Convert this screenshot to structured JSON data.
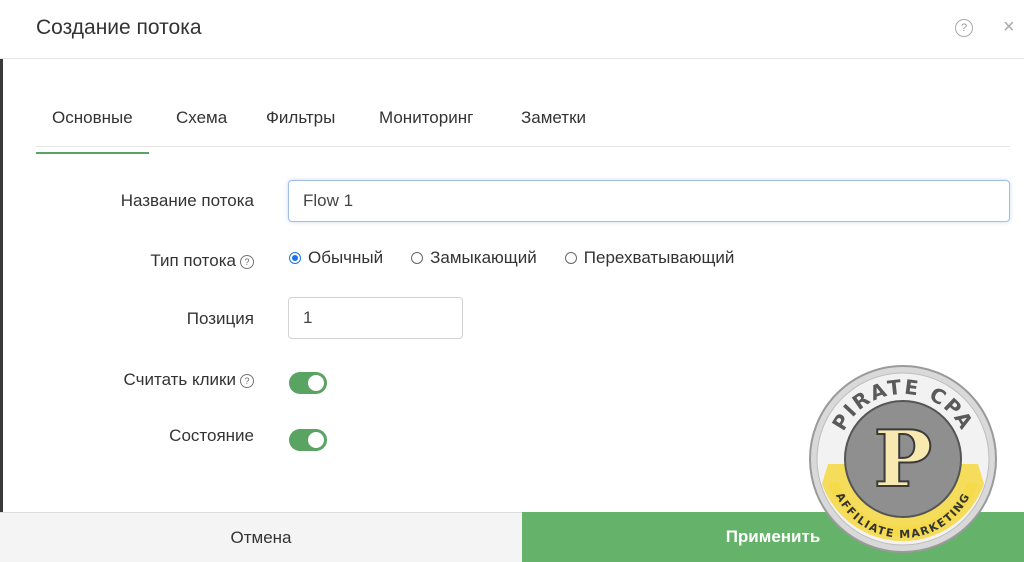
{
  "dialog": {
    "title": "Создание потока",
    "help_icon": "question-circle-icon",
    "close_icon": "close-icon",
    "close_glyph": "×",
    "help_glyph": "?"
  },
  "tabs": [
    {
      "label": "Основные",
      "active": true
    },
    {
      "label": "Схема",
      "active": false
    },
    {
      "label": "Фильтры",
      "active": false
    },
    {
      "label": "Мониторинг",
      "active": false
    },
    {
      "label": "Заметки",
      "active": false
    }
  ],
  "form": {
    "name": {
      "label": "Название потока",
      "value": "Flow 1"
    },
    "type": {
      "label": "Тип потока",
      "options": [
        {
          "label": "Обычный",
          "checked": true
        },
        {
          "label": "Замыкающий",
          "checked": false
        },
        {
          "label": "Перехватывающий",
          "checked": false
        }
      ]
    },
    "position": {
      "label": "Позиция",
      "value": "1"
    },
    "count_clicks": {
      "label": "Считать клики",
      "enabled": true
    },
    "state": {
      "label": "Состояние",
      "enabled": true
    }
  },
  "footer": {
    "cancel_label": "Отмена",
    "apply_label": "Применить"
  },
  "watermark": {
    "top_text": "PIRATE CPA",
    "bottom_text": "AFFILIATE MARKETING",
    "letter": "P"
  },
  "colors": {
    "accent_green": "#65b36a",
    "toggle_green": "#5aa463",
    "radio_blue": "#1a73e8",
    "watermark_yellow": "#f5d94a"
  }
}
